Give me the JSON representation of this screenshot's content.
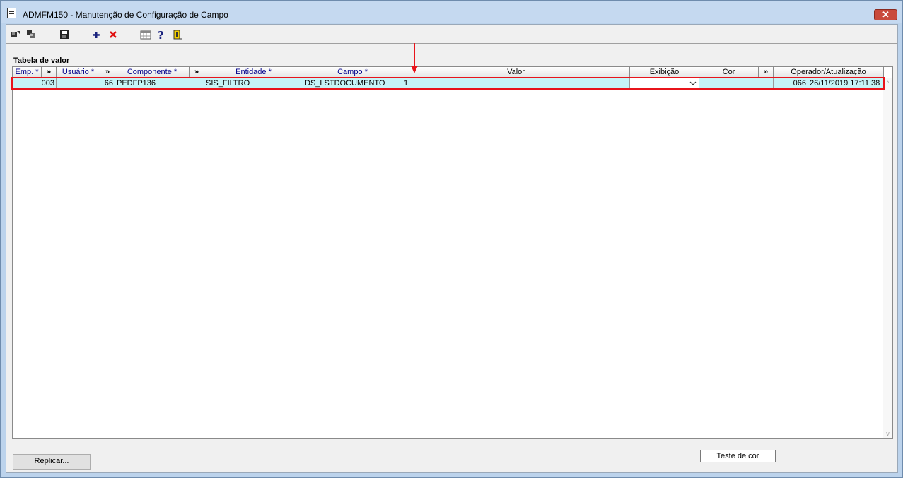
{
  "window": {
    "title": "ADMFM150 - Manutenção de Configuração de Campo",
    "close_label": "✕"
  },
  "toolbar": {
    "buttons": [
      "first-record-icon",
      "copy-record-icon",
      "save-icon",
      "add-icon",
      "delete-icon",
      "calendar-grid-icon",
      "help-icon",
      "exit-door-icon"
    ]
  },
  "group": {
    "label": "Tabela de valor"
  },
  "grid": {
    "columns": [
      {
        "label": "Emp. *"
      },
      {
        "label": "»"
      },
      {
        "label": "Usuário *"
      },
      {
        "label": "»"
      },
      {
        "label": "Componente *"
      },
      {
        "label": "»"
      },
      {
        "label": "Entidade *"
      },
      {
        "label": "Campo *"
      },
      {
        "label": "Valor"
      },
      {
        "label": "Exibição"
      },
      {
        "label": "Cor"
      },
      {
        "label": "»"
      },
      {
        "label": "Operador/Atualização"
      }
    ],
    "row": {
      "emp": "003",
      "usuario": "66",
      "componente": "PEDFP136",
      "entidade": "SIS_FILTRO",
      "campo": "DS_LSTDOCUMENTO",
      "valor": "1",
      "exibicao": "",
      "cor": "",
      "operador": "066",
      "atualizacao": "26/11/2019 17:11:38"
    },
    "scroll_up": "^",
    "scroll_down": "v"
  },
  "buttons": {
    "replicar": "Replicar...",
    "teste_cor": "Teste de cor"
  },
  "colors": {
    "row_selected": "#c6f4f7",
    "highlight": "#e8141b",
    "required_header": "#00008b"
  }
}
